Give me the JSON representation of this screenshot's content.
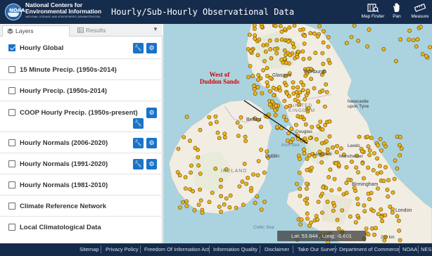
{
  "header": {
    "org_line1": "National Centers for",
    "org_line2": "Environmental Information",
    "org_line3": "NATIONAL OCEANIC AND ATMOSPHERIC ADMINISTRATION",
    "logo_text": "NOAA",
    "app_title": "Hourly/Sub-Hourly Observational Data",
    "tools": [
      {
        "label": "Map Finder",
        "icon": "map-finder-icon"
      },
      {
        "label": "Pan",
        "icon": "hand-pan-icon"
      },
      {
        "label": "Measure",
        "icon": "ruler-measure-icon"
      }
    ]
  },
  "sidebar": {
    "tabs": [
      {
        "label": "Layers",
        "icon": "layers-icon",
        "active": true
      },
      {
        "label": "Results",
        "icon": "table-results-icon",
        "active": false
      }
    ],
    "layers": [
      {
        "label": "Hourly Global",
        "checked": true,
        "buttons": [
          "wrench",
          "gear"
        ]
      },
      {
        "label": "15 Minute Precip. (1950s-2014)",
        "checked": false,
        "buttons": []
      },
      {
        "label": "Hourly Precip. (1950s-2014)",
        "checked": false,
        "buttons": []
      },
      {
        "label": "COOP Hourly Precip. (1950s-present)",
        "checked": false,
        "buttons": [
          "gear",
          "wrench"
        ]
      },
      {
        "label": "Hourly Normals (2006-2020)",
        "checked": false,
        "buttons": [
          "wrench",
          "gear"
        ]
      },
      {
        "label": "Hourly Normals (1991-2020)",
        "checked": false,
        "buttons": [
          "wrench",
          "gear"
        ]
      },
      {
        "label": "Hourly Normals (1981-2010)",
        "checked": false,
        "buttons": []
      },
      {
        "label": "Climate Reference Network",
        "checked": false,
        "buttons": []
      },
      {
        "label": "Local Climatological Data",
        "checked": false,
        "buttons": []
      }
    ]
  },
  "map": {
    "annotation": "West of\nDuddon Sands",
    "places": {
      "glasgow": "Glasgow",
      "edinburgh": "Edinburgh",
      "united_kingdom": "UNITED\nKINGDOM",
      "newcastle": "Newcastle\nupon Tyne",
      "belfast": "Belfast",
      "douglas": "Douglas",
      "irish_sea": "Irish Sea",
      "dublin": "Dublin",
      "ireland": "IRELAND",
      "leeds": "Leeds",
      "liverpool": "Liverpool",
      "manchester": "Manchester",
      "birmingham": "Birmingham",
      "london": "London",
      "celtic_sea": "Celtic Sea"
    },
    "coords": "Lat: 53.844 , Long: -0.601",
    "scale": "200 km",
    "colors": {
      "land": "#f1ede3",
      "sea": "#aad3df",
      "station": "#f2b418",
      "annotation": "#d10000"
    }
  },
  "footer": {
    "links": [
      "Sitemap",
      "Privacy Policy",
      "Freedom Of Information Act",
      "Information Quality",
      "Disclaimer",
      "Take Our Survey",
      "Department of Commerce",
      "NOAA",
      "NESDIS"
    ]
  }
}
